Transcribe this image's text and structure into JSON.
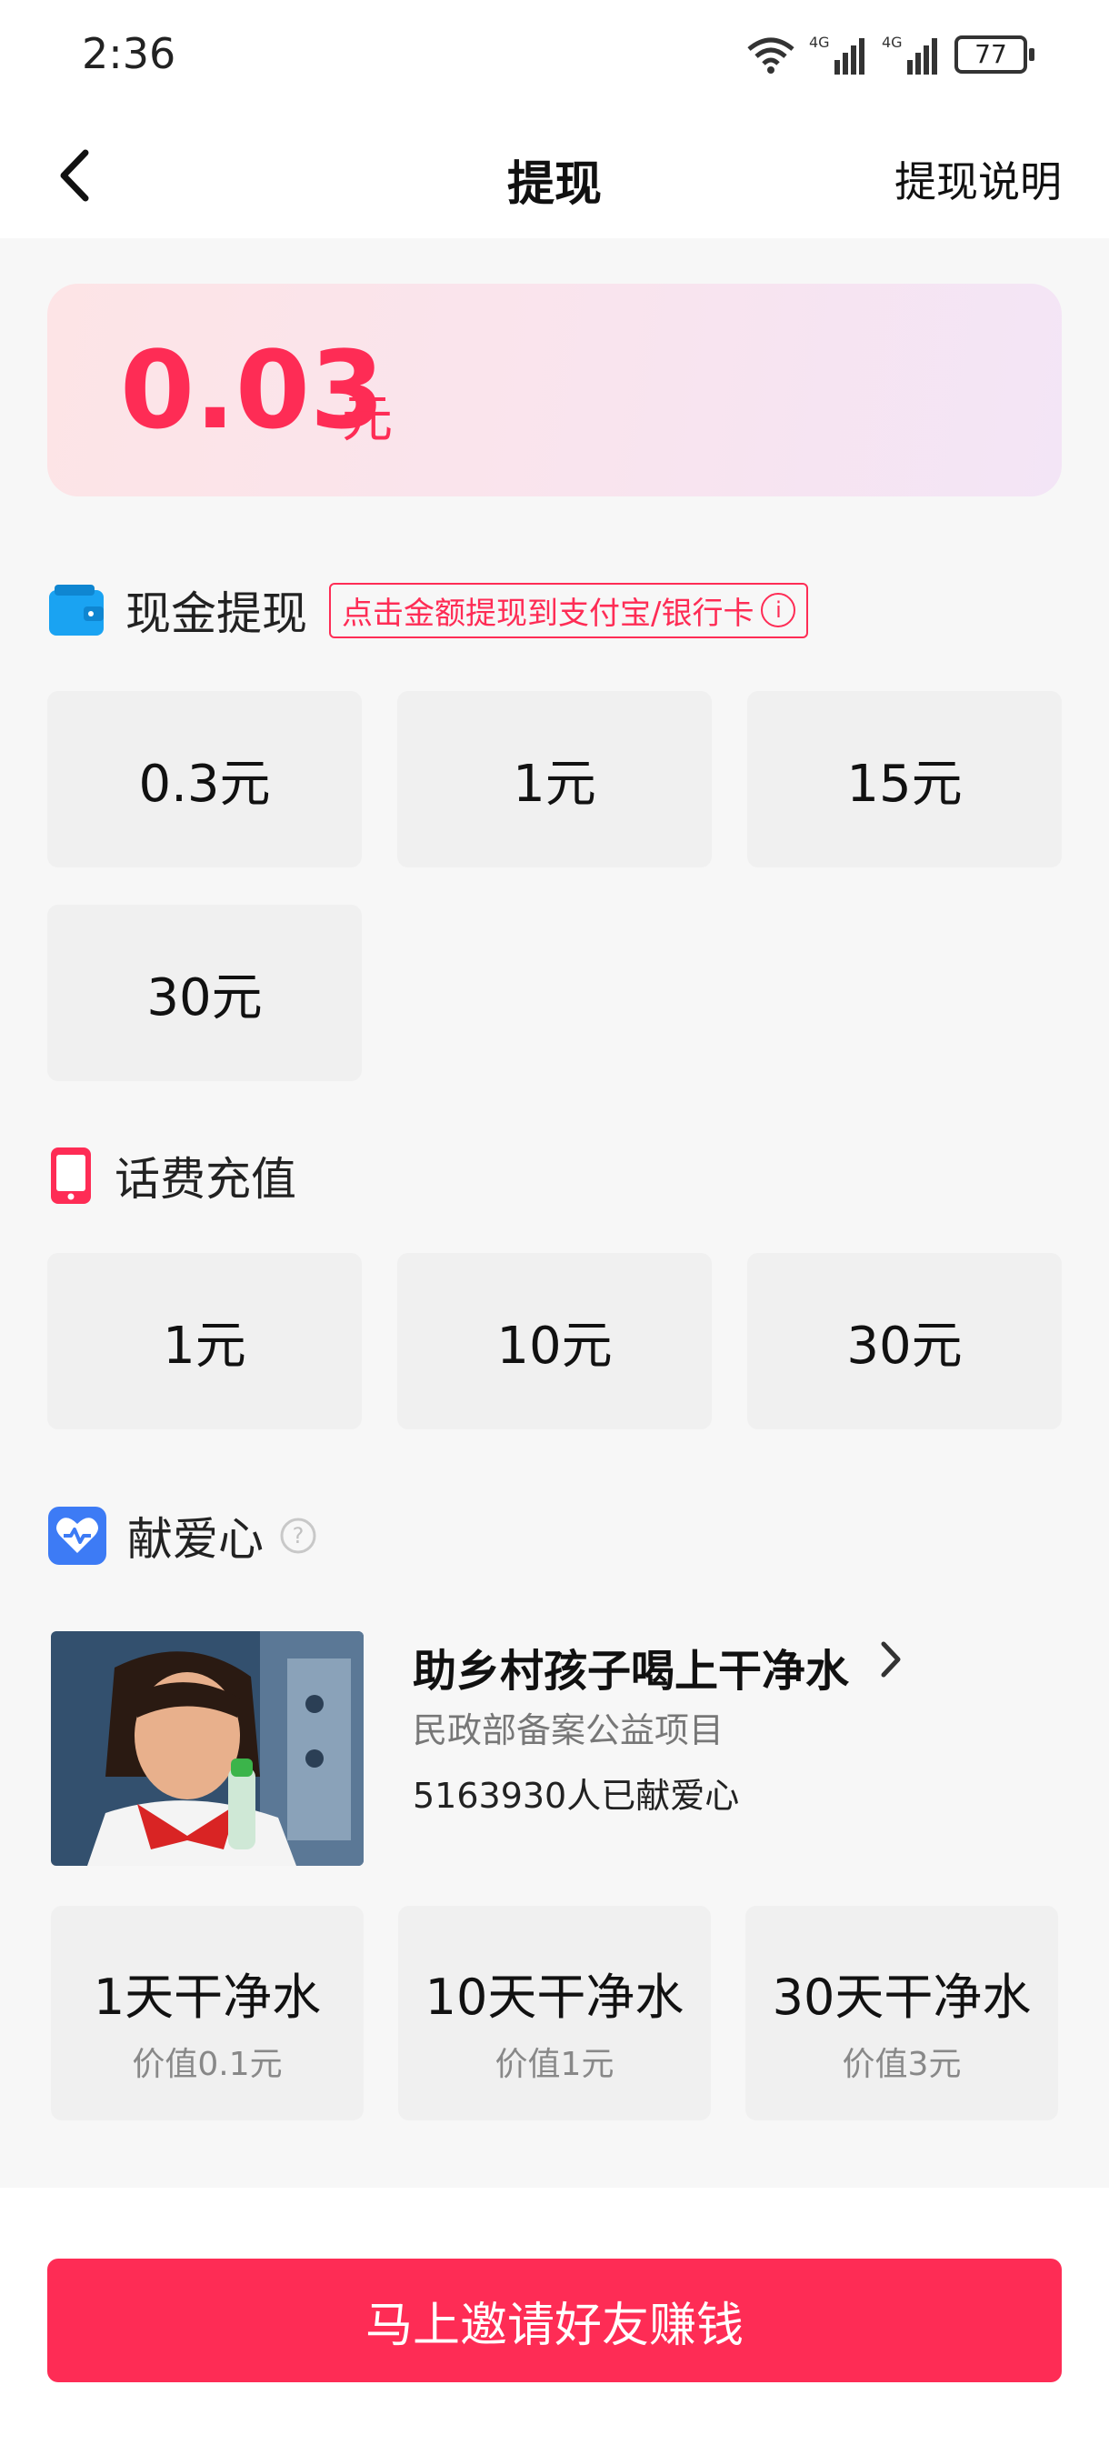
{
  "status": {
    "time": "2:36",
    "network1": "4G",
    "network2": "4G",
    "battery": "77"
  },
  "nav": {
    "title": "提现",
    "right_label": "提现说明"
  },
  "balance": {
    "amount": "0.03",
    "unit": "元"
  },
  "cash": {
    "title": "现金提现",
    "tag": "点击金额提现到支付宝/银行卡",
    "options": [
      "0.3元",
      "1元",
      "15元",
      "30元"
    ]
  },
  "phone": {
    "title": "话费充值",
    "options": [
      "1元",
      "10元",
      "30元"
    ]
  },
  "donate": {
    "title": "献爱心",
    "help_icon": "?",
    "project": {
      "title": "助乡村孩子喝上干净水",
      "subtitle": "民政部备案公益项目",
      "count": "5163930人已献爱心"
    },
    "options": [
      {
        "label": "1天干净水",
        "value": "价值0.1元"
      },
      {
        "label": "10天干净水",
        "value": "价值1元"
      },
      {
        "label": "30天干净水",
        "value": "价值3元"
      }
    ]
  },
  "cta": {
    "label": "马上邀请好友赚钱"
  },
  "colors": {
    "accent": "#fe2c55",
    "cash_icon": "#1aa3f2",
    "donate_icon": "#3d7bf5"
  },
  "icons": [
    "back-arrow-icon",
    "wallet-icon",
    "phone-icon",
    "heart-icon",
    "info-icon",
    "question-icon",
    "chevron-right-icon"
  ]
}
